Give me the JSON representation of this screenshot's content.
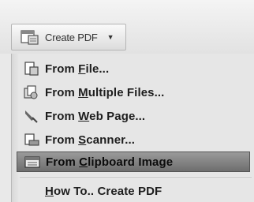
{
  "toolbar": {
    "create_button": {
      "label": "Create PDF",
      "icon": "create-pdf-icon",
      "dropdown_icon": "chevron-down-icon"
    }
  },
  "menu": {
    "items": [
      {
        "pre": "From ",
        "key": "F",
        "post": "ile...",
        "icon": "file-icon"
      },
      {
        "pre": "From ",
        "key": "M",
        "post": "ultiple Files...",
        "icon": "multiple-files-icon"
      },
      {
        "pre": "From ",
        "key": "W",
        "post": "eb Page...",
        "icon": "web-page-icon"
      },
      {
        "pre": "From ",
        "key": "S",
        "post": "canner...",
        "icon": "scanner-icon"
      },
      {
        "pre": "From ",
        "key": "C",
        "post": "lipboard Image",
        "icon": "clipboard-icon",
        "selected": true
      }
    ],
    "how_to": {
      "key": "H",
      "post": "ow To.. Create PDF"
    }
  }
}
